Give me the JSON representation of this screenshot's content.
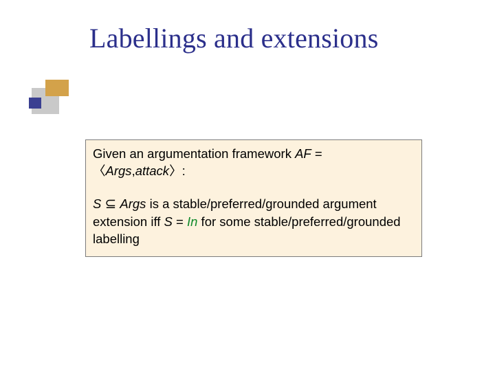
{
  "title": "Labellings and extensions",
  "box": {
    "p1_a": "Given an argumentation framework ",
    "p1_af": "AF",
    "p1_eq": " = ",
    "p1_lang": "〈",
    "p1_args": "Args",
    "p1_comma": ",",
    "p1_attack": "attack",
    "p1_rang": "〉:",
    "p2_S": "S ",
    "p2_sub": "⊆",
    "p2_sp": " ",
    "p2_args": "Args",
    "p2_a": " is a stable/preferred/grounded ",
    "p2_argext": "argument extension",
    "p2_iff": " iff ",
    "p2_Seq": "S",
    "p2_eqsym": " = ",
    "p2_In": "In",
    "p2_for": " for some stable/preferred/grounded ",
    "p2_lab": "labelling"
  }
}
